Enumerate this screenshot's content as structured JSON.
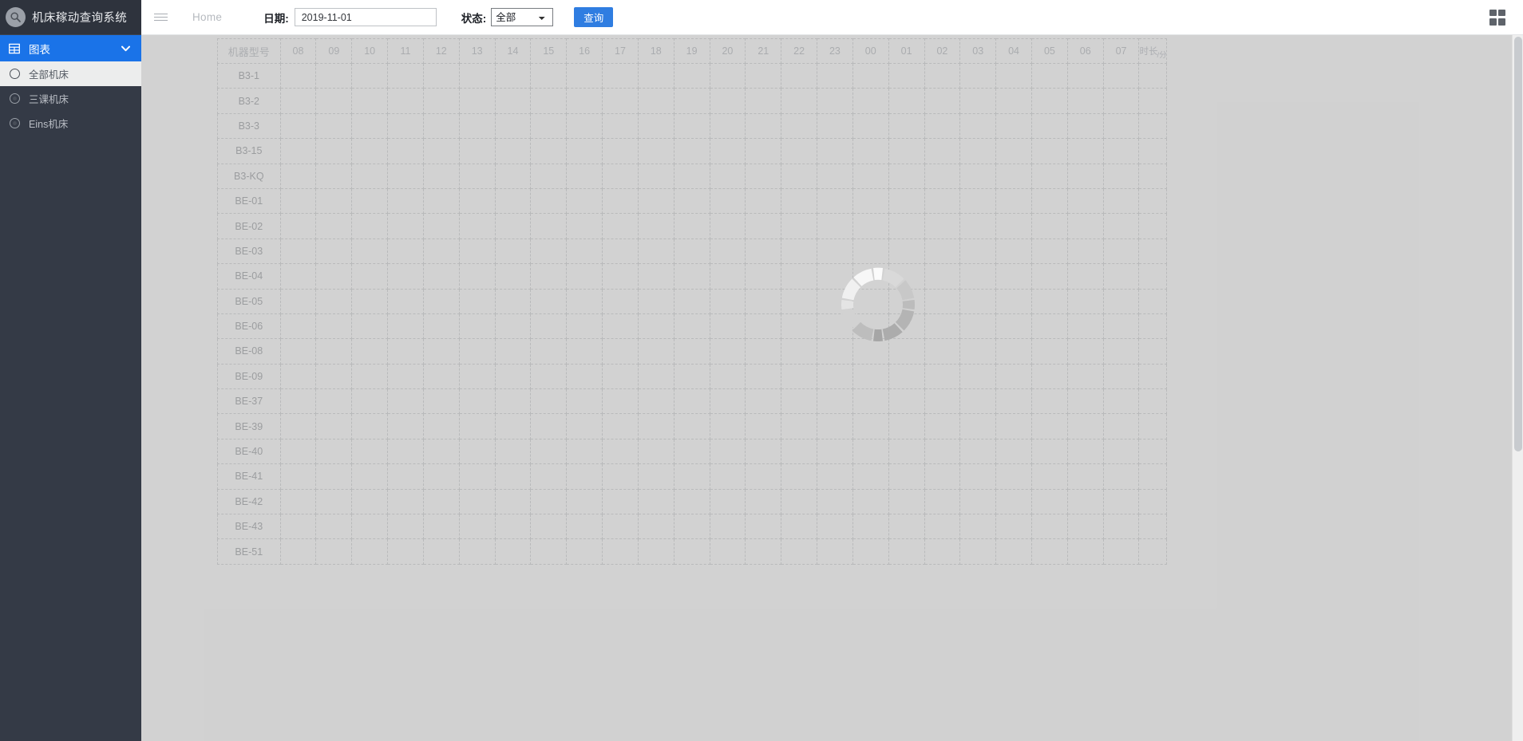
{
  "app": {
    "title": "机床稼动查询系统",
    "logo_icon": "magnifier-badge-icon"
  },
  "sidebar": {
    "group": {
      "label": "图表",
      "icon": "grid-table-icon",
      "chevron": "chevron-down-icon",
      "accent_color": "#1a73e8"
    },
    "items": [
      {
        "label": "全部机床",
        "icon": "radio-icon",
        "active": true
      },
      {
        "label": "三课机床",
        "icon": "radio-icon",
        "active": false
      },
      {
        "label": "Eins机床",
        "icon": "radio-icon",
        "active": false
      }
    ]
  },
  "topbar": {
    "menu_toggle_icon": "hamburger-icon",
    "breadcrumb": "Home",
    "date_label": "日期:",
    "date_value": "2019-11-01",
    "date_placeholder": "2019-11-01",
    "status_label": "状态:",
    "status_value": "全部",
    "status_options": [
      "全部"
    ],
    "query_button": "查询",
    "apps_icon": "grid-apps-icon"
  },
  "main": {
    "loading": true,
    "loading_icon": "circular-spinner-icon",
    "table": {
      "name_header": "机器型号",
      "hours": [
        "08",
        "09",
        "10",
        "11",
        "12",
        "13",
        "14",
        "15",
        "16",
        "17",
        "18",
        "19",
        "20",
        "21",
        "22",
        "23",
        "00",
        "01",
        "02",
        "03",
        "04",
        "05",
        "06",
        "07"
      ],
      "duration_header_main": "时长",
      "duration_header_sub": "/分",
      "rows": [
        {
          "name": "B3-1"
        },
        {
          "name": "B3-2"
        },
        {
          "name": "B3-3"
        },
        {
          "name": "B3-15"
        },
        {
          "name": "B3-KQ"
        },
        {
          "name": "BE-01"
        },
        {
          "name": "BE-02"
        },
        {
          "name": "BE-03"
        },
        {
          "name": "BE-04"
        },
        {
          "name": "BE-05"
        },
        {
          "name": "BE-06"
        },
        {
          "name": "BE-08"
        },
        {
          "name": "BE-09"
        },
        {
          "name": "BE-37"
        },
        {
          "name": "BE-39"
        },
        {
          "name": "BE-40"
        },
        {
          "name": "BE-41"
        },
        {
          "name": "BE-42"
        },
        {
          "name": "BE-43"
        },
        {
          "name": "BE-51"
        }
      ]
    }
  },
  "colors": {
    "sidebar_bg": "#343a46",
    "accent_blue": "#1a73e8",
    "button_blue": "#2f7de1",
    "content_bg": "#f1f1f1",
    "veil": "#bebebe"
  }
}
